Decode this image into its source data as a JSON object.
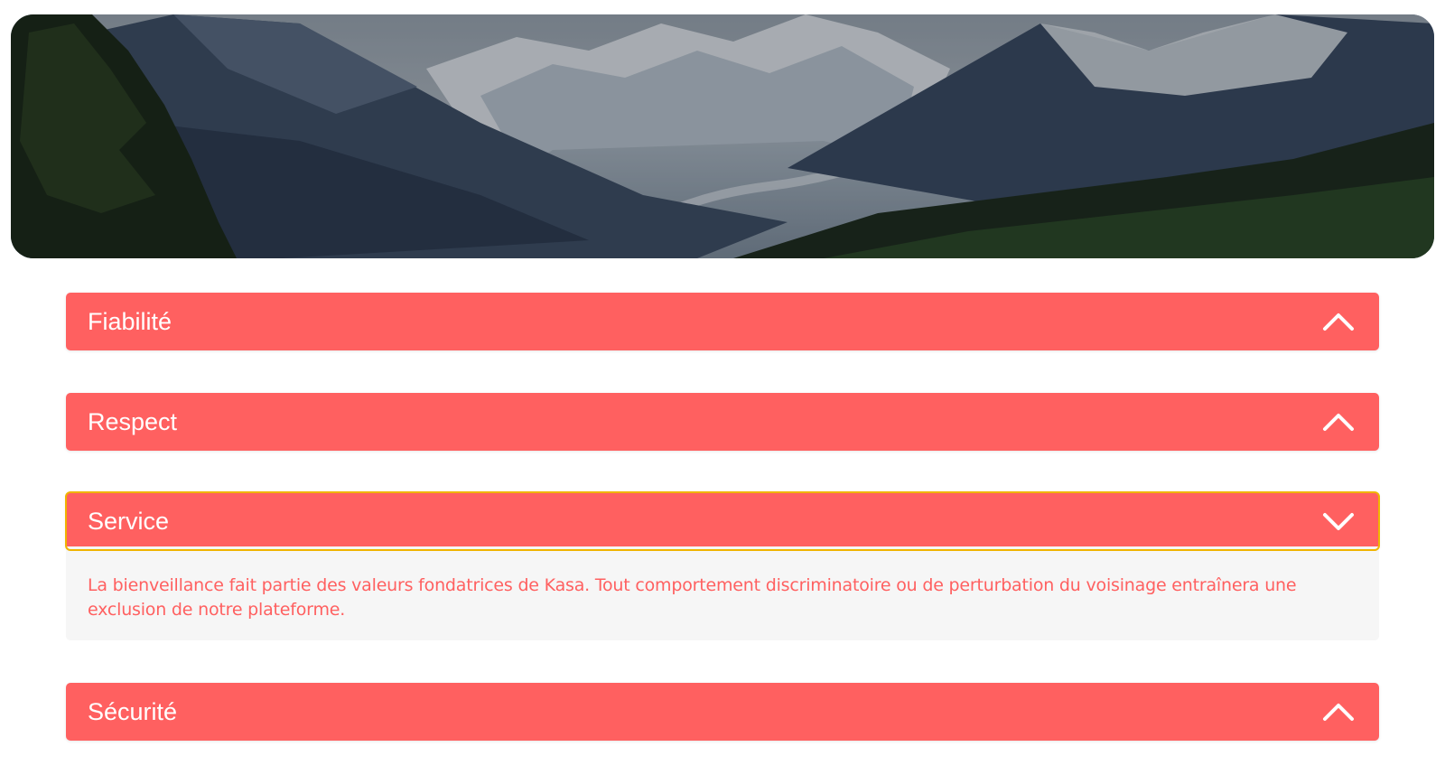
{
  "banner": {
    "image": "mountain-valley-landscape"
  },
  "colors": {
    "accent": "#ff6060",
    "body_background": "#f6f6f6",
    "focus_outline": "#f0b400"
  },
  "collapses": [
    {
      "title": "Fiabilité",
      "expanded": false,
      "icon": "chevron-up-icon"
    },
    {
      "title": "Respect",
      "expanded": false,
      "icon": "chevron-up-icon"
    },
    {
      "title": "Service",
      "expanded": true,
      "icon": "chevron-down-icon",
      "content": "La bienveillance fait partie des valeurs fondatrices de Kasa. Tout comportement discriminatoire ou de perturbation du voisinage entraînera une exclusion de notre plateforme."
    },
    {
      "title": "Sécurité",
      "expanded": false,
      "icon": "chevron-up-icon"
    }
  ]
}
